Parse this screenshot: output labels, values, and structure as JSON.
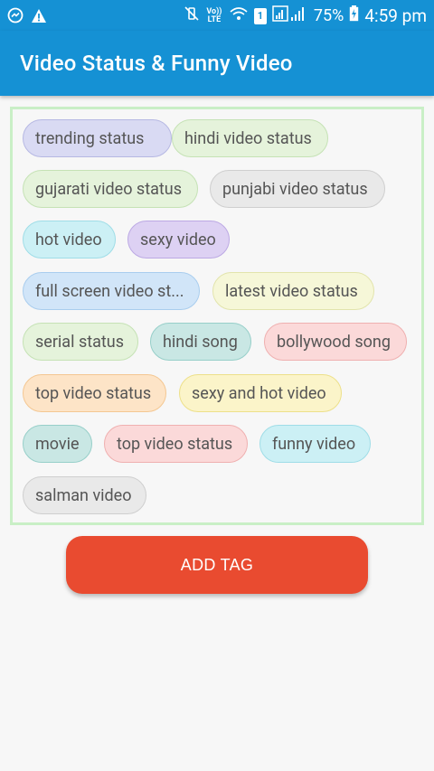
{
  "status_bar": {
    "battery": "75%",
    "time": "4:59 pm",
    "lte_label": "Vo)) LTE",
    "sim_label": "1"
  },
  "app_bar": {
    "title": "Video Status & Funny Video"
  },
  "tags": [
    {
      "label": "trending status"
    },
    {
      "label": "hindi video status"
    },
    {
      "label": "gujarati video status"
    },
    {
      "label": "punjabi video status"
    },
    {
      "label": "hot video"
    },
    {
      "label": "sexy video"
    },
    {
      "label": "full screen video st..."
    },
    {
      "label": "latest video status"
    },
    {
      "label": "serial status"
    },
    {
      "label": "hindi song"
    },
    {
      "label": "bollywood song"
    },
    {
      "label": "top video status"
    },
    {
      "label": "sexy and hot video"
    },
    {
      "label": "movie"
    },
    {
      "label": "top video status"
    },
    {
      "label": "funny video"
    },
    {
      "label": "salman video"
    }
  ],
  "add_button": {
    "label": "ADD TAG"
  },
  "colors": {
    "primary": "#1591d4",
    "accent_button": "#e94b30",
    "tag_box_border": "#c9efc6"
  }
}
